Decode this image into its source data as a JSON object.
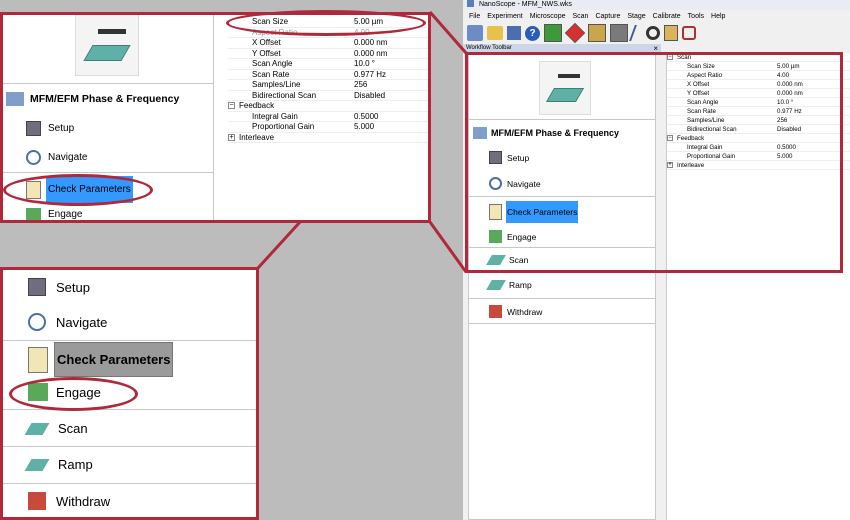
{
  "app": {
    "window_title": "NanoScope - MFM_NWS.wks",
    "menu": [
      "File",
      "Experiment",
      "Microscope",
      "Scan",
      "Capture",
      "Stage",
      "Calibrate",
      "Tools",
      "Help"
    ],
    "toolbar_title": "Workflow Toolbar",
    "toolbar_close": "×"
  },
  "workflow": {
    "title": "MFM/EFM Phase & Frequency",
    "items": {
      "setup": "Setup",
      "navigate": "Navigate",
      "check": "Check Parameters",
      "engage": "Engage",
      "scan": "Scan",
      "ramp": "Ramp",
      "withdraw": "Withdraw"
    }
  },
  "params": {
    "scan_group": "Scan",
    "scan_size": {
      "k": "Scan Size",
      "v": "5.00 µm"
    },
    "aspect_ratio": {
      "k": "Aspect Ratio",
      "v": "4.00"
    },
    "x_offset": {
      "k": "X Offset",
      "v": "0.000 nm"
    },
    "y_offset": {
      "k": "Y Offset",
      "v": "0.000 nm"
    },
    "scan_angle": {
      "k": "Scan Angle",
      "v": "10.0 °"
    },
    "scan_rate": {
      "k": "Scan Rate",
      "v": "0.977 Hz"
    },
    "samples_line": {
      "k": "Samples/Line",
      "v": "256"
    },
    "bidirectional": {
      "k": "Bidirectional Scan",
      "v": "Disabled"
    },
    "feedback_group": "Feedback",
    "integral_gain": {
      "k": "Integral Gain",
      "v": "0.5000"
    },
    "proportional_gain": {
      "k": "Proportional Gain",
      "v": "5.000"
    },
    "interleave_group": "Interleave",
    "zoom_partial": {
      "k": "Aspect Ratio",
      "v": "4.00"
    }
  },
  "colors": {
    "highlight": "#b0283a",
    "selection": "#3399ff",
    "selection_gray": "#9a9a9a",
    "background": "#bcbcbc"
  }
}
